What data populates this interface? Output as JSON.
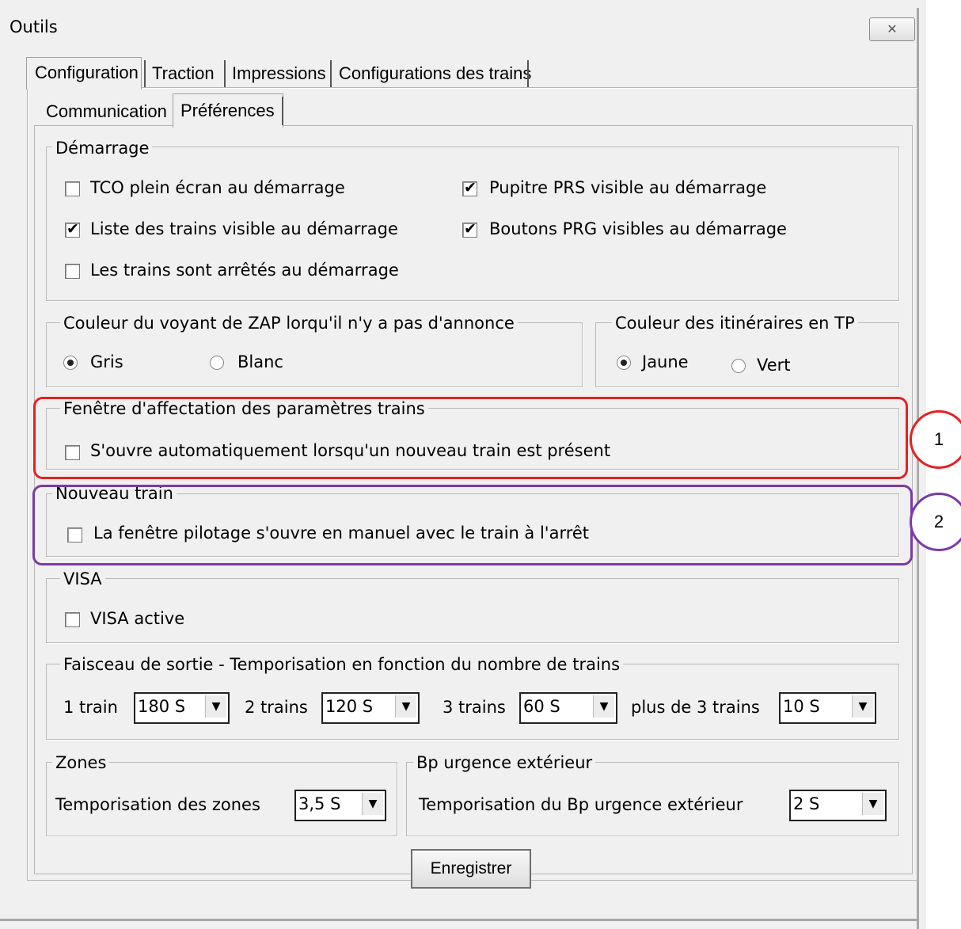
{
  "window": {
    "title": "Outils",
    "close_icon": "close-icon"
  },
  "tabs": [
    "Configuration",
    "Traction",
    "Impressions",
    "Configurations des trains"
  ],
  "subtabs": [
    "Communication",
    "Préférences"
  ],
  "demarrage": {
    "label": "Démarrage",
    "options": [
      {
        "label": "TCO plein écran au démarrage",
        "checked": false
      },
      {
        "label": "Pupitre PRS visible au démarrage",
        "checked": true
      },
      {
        "label": "Liste des trains visible au démarrage",
        "checked": true
      },
      {
        "label": "Boutons PRG visibles au démarrage",
        "checked": true
      },
      {
        "label": "Les trains sont arrêtés au démarrage",
        "checked": false
      }
    ]
  },
  "zap": {
    "label": "Couleur du voyant de ZAP lorqu'il n'y a pas d'annonce",
    "options": [
      "Gris",
      "Blanc"
    ],
    "selected": "Gris"
  },
  "itineraires": {
    "label": "Couleur des itinéraires en TP",
    "options": [
      "Jaune",
      "Vert"
    ],
    "selected": "Jaune"
  },
  "fenetre": {
    "label": "Fenêtre d'affectation des paramètres trains",
    "option": "S'ouvre automatiquement lorsqu'un nouveau train est présent",
    "checked": false
  },
  "nouveau": {
    "label": "Nouveau train",
    "option": "La fenêtre pilotage s'ouvre en manuel avec le train à l'arrêt",
    "checked": false
  },
  "visa": {
    "label": "VISA",
    "option": "VISA active",
    "checked": false
  },
  "faisceau": {
    "label": "Faisceau de sortie - Temporisation en fonction du nombre de trains",
    "items": [
      {
        "label": "1 train",
        "value": "180 S"
      },
      {
        "label": "2 trains",
        "value": "120 S"
      },
      {
        "label": "3 trains",
        "value": "60 S"
      },
      {
        "label": "plus de 3 trains",
        "value": "10 S"
      }
    ]
  },
  "zones": {
    "label": "Zones",
    "field_label": "Temporisation des zones",
    "value": "3,5 S"
  },
  "bp": {
    "label": "Bp urgence extérieur",
    "field_label": "Temporisation du Bp urgence extérieur",
    "value": "2 S"
  },
  "annotations": [
    "1",
    "2"
  ],
  "colors": {
    "highlight_1": "#e62020",
    "highlight_2": "#7a3aa8"
  },
  "save_button": "Enregistrer"
}
